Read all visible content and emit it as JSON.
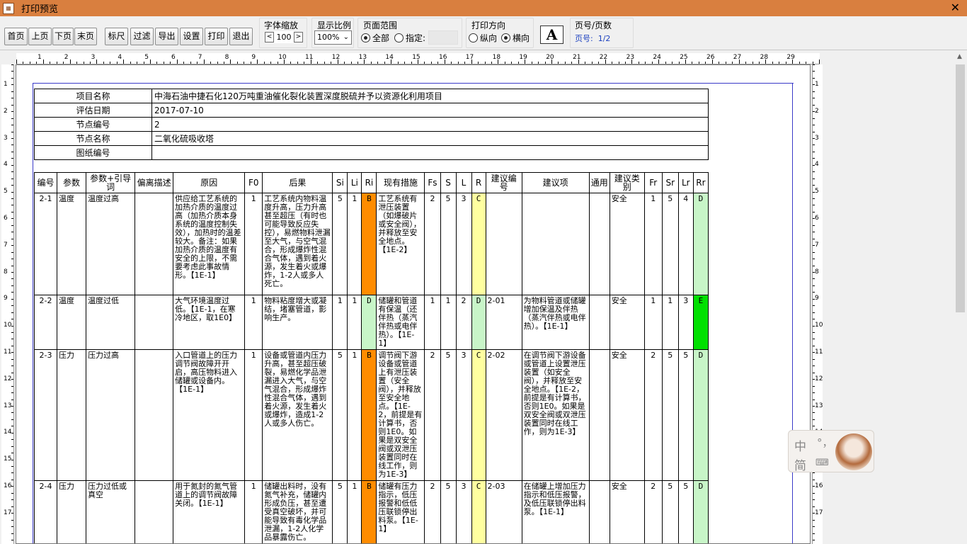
{
  "window": {
    "title": "打印预览",
    "close": "✕"
  },
  "toolbar": {
    "buttons": [
      "首页",
      "上页",
      "下页",
      "末页",
      "标尺",
      "过滤",
      "导出",
      "设置",
      "打印",
      "退出"
    ],
    "font_zoom": {
      "label": "字体缩放",
      "dec": "<",
      "value": "100",
      "inc": ">"
    },
    "display_ratio": {
      "label": "显示比例",
      "value": "100%"
    },
    "page_range": {
      "label": "页面范围",
      "all": "全部",
      "specify": "指定:"
    },
    "orientation": {
      "label": "打印方向",
      "portrait": "纵向",
      "landscape": "横向"
    },
    "page_info": {
      "label": "页号/页数",
      "value": "页号:  1/2"
    }
  },
  "ruler": {
    "h": [
      "1",
      "2",
      "3",
      "4",
      "5",
      "6",
      "7",
      "8",
      "9",
      "10",
      "11",
      "12",
      "13",
      "14",
      "15",
      "16",
      "17",
      "18",
      "19",
      "20",
      "21",
      "22",
      "23",
      "24",
      "25",
      "26",
      "27",
      "28",
      "29"
    ],
    "v": [
      "1",
      "2",
      "3",
      "4",
      "5",
      "6",
      "7",
      "8",
      "9",
      "10",
      "11",
      "12",
      "13",
      "14",
      "15",
      "16",
      "17"
    ]
  },
  "info": [
    {
      "k": "项目名称",
      "v": "中海石油中捷石化120万吨重油催化裂化装置深度脱硫并予以资源化利用项目"
    },
    {
      "k": "评估日期",
      "v": "2017-07-10"
    },
    {
      "k": "节点编号",
      "v": "2"
    },
    {
      "k": "节点名称",
      "v": "二氧化硫吸收塔"
    },
    {
      "k": "图纸编号",
      "v": ""
    }
  ],
  "headers": [
    "编号",
    "参数",
    "参数+引导词",
    "偏离描述",
    "原因",
    "F0",
    "后果",
    "Si",
    "Li",
    "Ri",
    "现有措施",
    "Fs",
    "S",
    "L",
    "R",
    "建议编号",
    "建议项",
    "通用",
    "建议类别",
    "Fr",
    "Sr",
    "Lr",
    "Rr"
  ],
  "rows": [
    {
      "id": "2-1",
      "param": "温度",
      "guide": "温度过高",
      "dev": "",
      "cause": "供应给工艺系统的加热介质的温度过高（加热介质本身系统的温度控制失效），加热时的温差较大。备注：如果加热介质的温度有安全的上限，不需要考虑此事故情形。【1E-1】",
      "f0": "1",
      "cons": "工艺系统内物料温度升高，压力升高甚至超压（有时也可能导致反应失控），易燃物料泄漏至大气，与空气混合，形成爆炸性混合气体，遇到着火源，发生着火或爆炸，1-2人或多人死亡。",
      "si": "5",
      "li": "1",
      "ri": "B",
      "meas": "工艺系统有泄压装置（如爆破片或安全阀），并释放至安全地点。【1E-2】",
      "fs": "2",
      "s": "5",
      "l": "3",
      "r": "C",
      "sid": "",
      "sug": "",
      "gen": "",
      "cat": "安全",
      "fr": "1",
      "sr": "5",
      "lr": "4",
      "rr": "D"
    },
    {
      "id": "2-2",
      "param": "温度",
      "guide": "温度过低",
      "dev": "",
      "cause": "大气环境温度过低。【1E-1，在寒冷地区，取1E0】",
      "f0": "1",
      "cons": "物料粘度增大或凝结，堵塞管道，影响生产。",
      "si": "1",
      "li": "1",
      "ri": "D",
      "meas": "储罐和管道有保温（还伴热（蒸汽伴热或电伴热）。【1E-1】",
      "fs": "1",
      "s": "1",
      "l": "2",
      "r": "D",
      "sid": "2-01",
      "sug": "为物料管道或储罐增加保温及伴热（蒸汽伴热或电伴热）。【1E-1】",
      "gen": "",
      "cat": "安全",
      "fr": "1",
      "sr": "1",
      "lr": "3",
      "rr": "E"
    },
    {
      "id": "2-3",
      "param": "压力",
      "guide": "压力过高",
      "dev": "",
      "cause": "入口管道上的压力调节阀故障开开启，高压物料进入储罐或设备内。【1E-1】",
      "f0": "1",
      "cons": "设备或管道内压力升高，甚至超压破裂，易燃化学品泄漏进入大气，与空气混合，形成爆炸性混合气体，遇到着火源，发生着火或爆炸，造成1-2人或多人伤亡。",
      "si": "5",
      "li": "1",
      "ri": "B",
      "meas": "调节阀下游设备或管道上有泄压装置（安全阀），并释放至安全地点。【1E-2，前提是有计算书，否则1E0。如果是双安全阀或双泄压装置同时在线工作，则为1E-3】",
      "fs": "2",
      "s": "5",
      "l": "3",
      "r": "C",
      "sid": "2-02",
      "sug": "在调节阀下游设备或管道上设置泄压装置（如安全阀），并释放至安全地点。【1E-2，前提是有计算书，否则1E0。如果是双安全阀或双泄压装置同时在线工作，则为1E-3】",
      "gen": "",
      "cat": "安全",
      "fr": "2",
      "sr": "5",
      "lr": "5",
      "rr": "D"
    },
    {
      "id": "2-4",
      "param": "压力",
      "guide": "压力过低或真空",
      "dev": "",
      "cause": "用于氮封的氮气管道上的调节阀故障关闭。【1E-1】",
      "f0": "1",
      "cons": "储罐出料时，没有氮气补充，储罐内形成负压，甚至遭受真空破坏，并可能导致有毒化学品泄漏，1-2人化学品暴露伤亡。",
      "si": "5",
      "li": "1",
      "ri": "B",
      "meas": "储罐有压力指示，低压报警和低低压联锁停出料泵。【1E-1】",
      "fs": "2",
      "s": "5",
      "l": "3",
      "r": "C",
      "sid": "2-03",
      "sug": "在储罐上增加压力指示和低压报警，及低压联锁停出料泵。【1E-1】",
      "gen": "",
      "cat": "安全",
      "fr": "2",
      "sr": "5",
      "lr": "5",
      "rr": "D"
    }
  ],
  "ime": {
    "zh": "中",
    "punct": "°，",
    "jian": "简",
    "kb": "⌨"
  },
  "colors": {
    "titlebar": "#d97f3f",
    "B": "#ff8c00",
    "C": "#ffffa0",
    "D": "#c8f5c8",
    "E": "#00e000"
  }
}
